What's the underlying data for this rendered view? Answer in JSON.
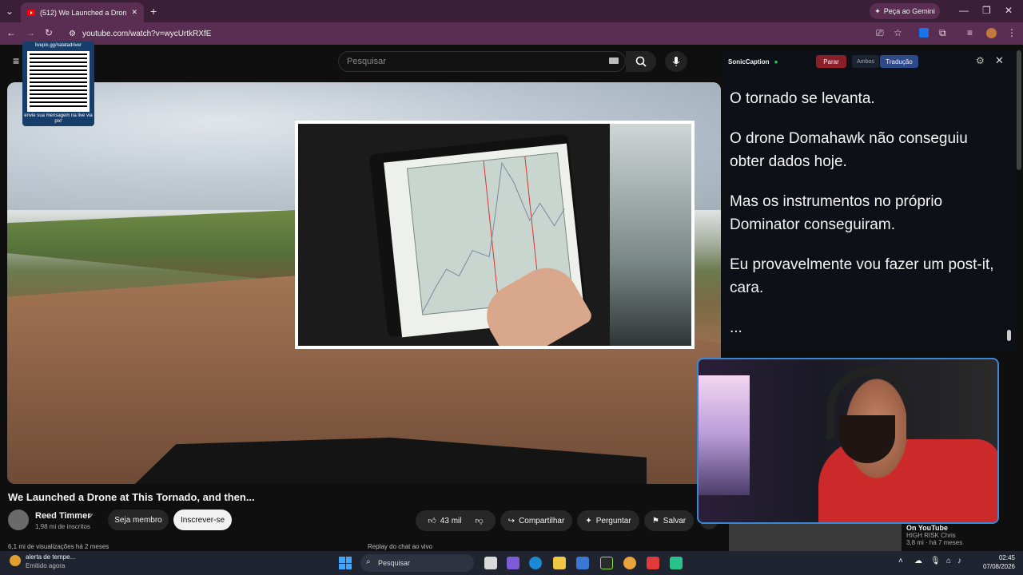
{
  "browser": {
    "tab_title": "(512) We Launched a Dron",
    "new_tab": "+",
    "gemini_label": "Peça ao Gemini",
    "url": "youtube.com/watch?v=wycUrtkRXfE"
  },
  "youtube": {
    "search_placeholder": "Pesquisar",
    "video_title": "We Launched a Drone at This Tornado, and then...",
    "channel_name": "Reed Timmer",
    "subscribers": "1,98 mi de inscritos",
    "member_button": "Seja membro",
    "subscribe_button": "Inscrever-se",
    "likes": "43 mil",
    "share_button": "Compartilhar",
    "ask_button": "Perguntar",
    "save_button": "Salvar",
    "views_line": "6,1 mi de visualizações  há 2 meses",
    "replay_label": "Replay do chat ao vivo",
    "rec_title": "On YouTube",
    "rec_channel": "HIGH RISK Chris",
    "rec_meta": "3,8 mi · há 7 meses"
  },
  "qr": {
    "top_text": "livepix.gg/nalatadriver",
    "bottom_text": "envie sua mensagem na live via pix!"
  },
  "caption_panel": {
    "brand": "SonicCaption",
    "stop": "Parar",
    "both": "Ambos",
    "translate": "Tradução",
    "lines": [
      "O tornado se levanta.",
      "O drone Domahawk não conseguiu obter dados hoje.",
      "Mas os instrumentos no próprio Dominator conseguiram.",
      "Eu provavelmente vou fazer um post-it, cara.",
      "..."
    ]
  },
  "taskbar": {
    "weather_title": "alerta de tempe...",
    "weather_sub": "Emitido agora",
    "search": "Pesquisar",
    "time": "02:45",
    "date": "07/08/2026"
  }
}
